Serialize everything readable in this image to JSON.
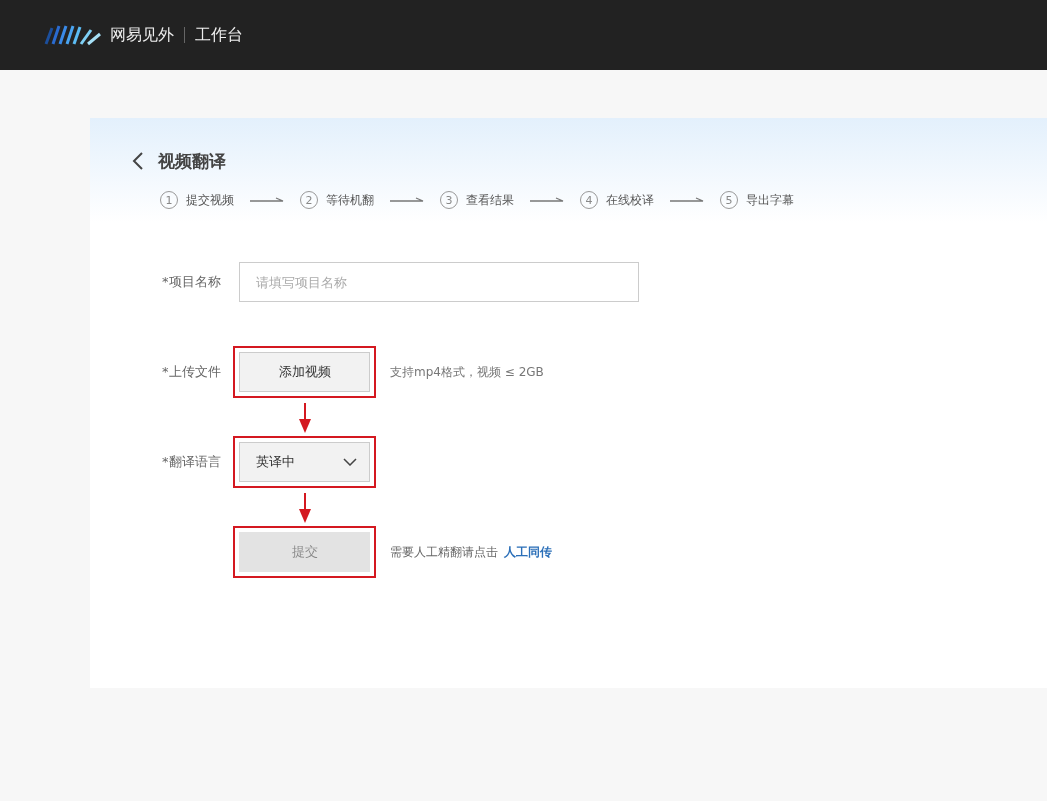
{
  "header": {
    "brand": "网易见外",
    "section": "工作台"
  },
  "page": {
    "title": "视频翻译",
    "steps": [
      {
        "number": "1",
        "label": "提交视频"
      },
      {
        "number": "2",
        "label": "等待机翻"
      },
      {
        "number": "3",
        "label": "查看结果"
      },
      {
        "number": "4",
        "label": "在线校译"
      },
      {
        "number": "5",
        "label": "导出字幕"
      }
    ]
  },
  "form": {
    "project_name": {
      "label": "*项目名称",
      "placeholder": "请填写项目名称"
    },
    "upload": {
      "label": "*上传文件",
      "button": "添加视频",
      "hint": "支持mp4格式，视频 ≤ 2GB",
      "highlighted": true
    },
    "language": {
      "label": "*翻译语言",
      "value": "英译中",
      "highlighted": true
    },
    "submit": {
      "button": "提交",
      "disabled": true,
      "highlighted": true,
      "note": "需要人工精翻请点击",
      "link": "人工同传"
    }
  }
}
